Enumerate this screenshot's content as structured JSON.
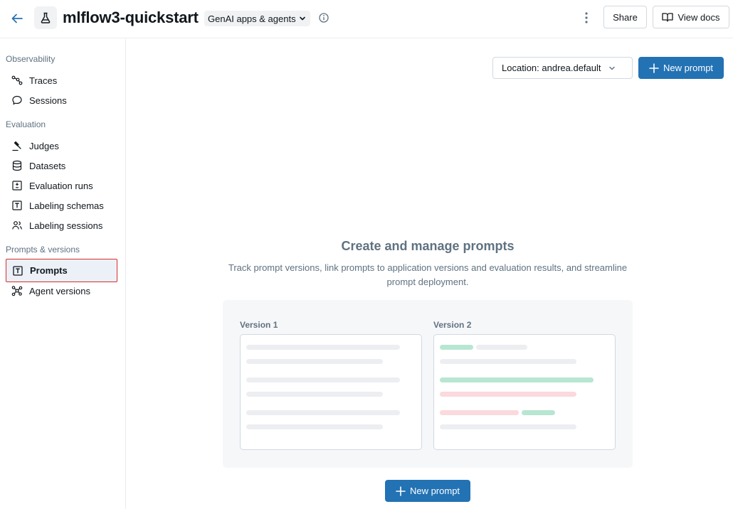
{
  "header": {
    "title": "mlflow3-quickstart",
    "type_dropdown": "GenAI apps & agents",
    "share_label": "Share",
    "docs_label": "View docs"
  },
  "sidebar": {
    "sections": [
      {
        "label": "Observability",
        "items": [
          {
            "label": "Traces",
            "icon": "traces-icon"
          },
          {
            "label": "Sessions",
            "icon": "chat-bubble-icon"
          }
        ]
      },
      {
        "label": "Evaluation",
        "items": [
          {
            "label": "Judges",
            "icon": "gavel-icon"
          },
          {
            "label": "Datasets",
            "icon": "database-icon"
          },
          {
            "label": "Evaluation runs",
            "icon": "plus-minus-box-icon"
          },
          {
            "label": "Labeling schemas",
            "icon": "text-box-icon"
          },
          {
            "label": "Labeling sessions",
            "icon": "users-icon"
          }
        ]
      },
      {
        "label": "Prompts & versions",
        "items": [
          {
            "label": "Prompts",
            "icon": "text-box-icon",
            "active": true
          },
          {
            "label": "Agent versions",
            "icon": "models-icon"
          }
        ]
      }
    ]
  },
  "main": {
    "location_label": "Location: andrea.default",
    "new_prompt_label": "New prompt",
    "empty_title": "Create and manage prompts",
    "empty_description": "Track prompt versions, link prompts to application versions and evaluation results, and streamline prompt deployment.",
    "version1_label": "Version 1",
    "version2_label": "Version 2"
  },
  "colors": {
    "primary": "#2272b4",
    "active_bg": "#ebf1f7",
    "highlight_border": "#d92d2d",
    "diff_added": "#b7e6d2",
    "diff_removed": "#fbd9dd"
  }
}
